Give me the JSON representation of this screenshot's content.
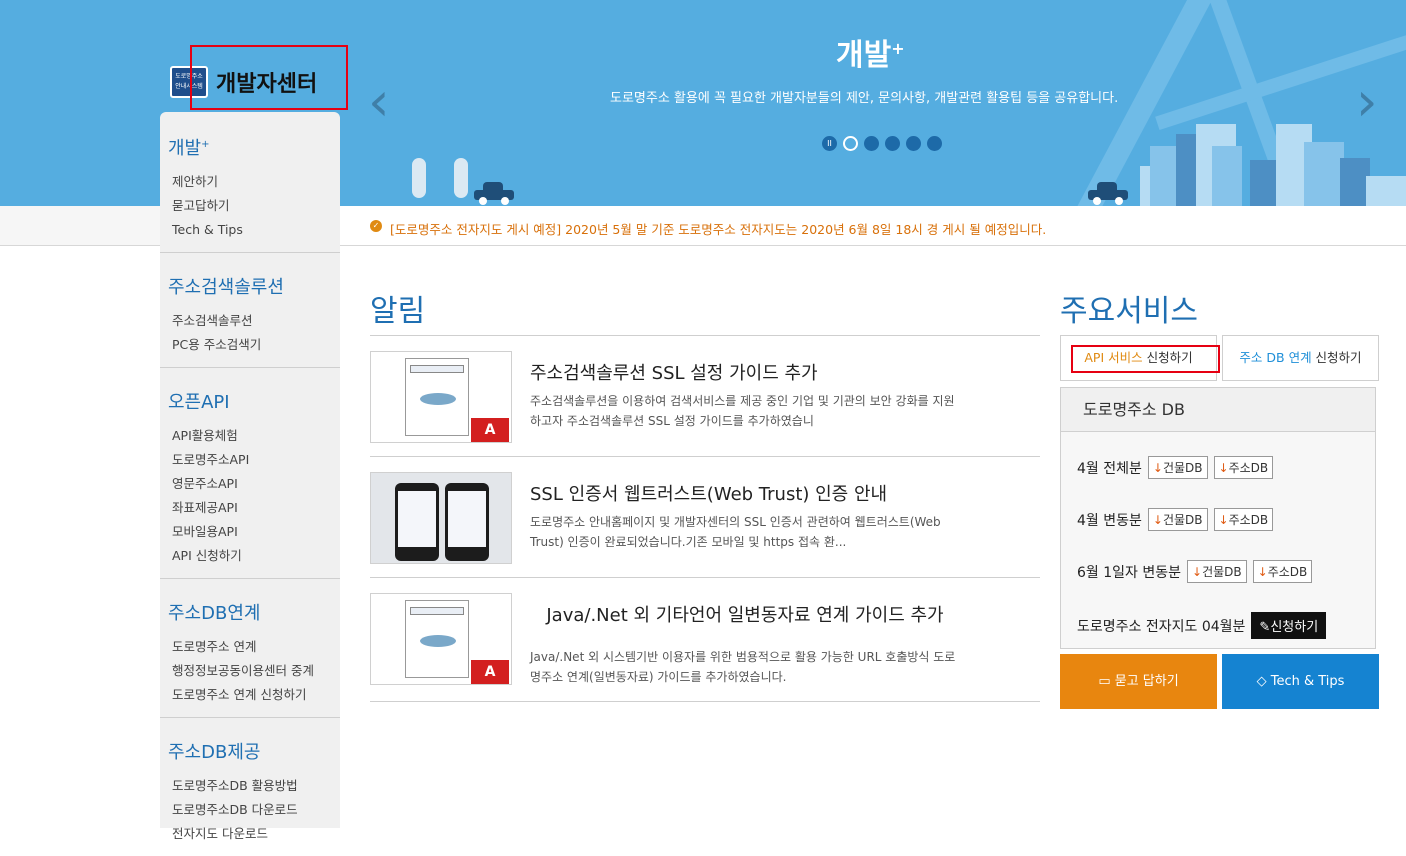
{
  "banner": {
    "title": "개발",
    "title_sup": "+",
    "subtitle": "도로명주소 활용에 꼭 필요한 개발자분들의 제안, 문의사항, 개발관련 활용팁 등을 공유합니다.",
    "prev_arrow": "‹",
    "next_arrow": "›",
    "pause_symbol": "II"
  },
  "logo": {
    "badge_line1": "도로명주소",
    "badge_line2": "안내시스템",
    "text": "개발자센터"
  },
  "sidebar": {
    "sections": [
      {
        "heading": "개발",
        "heading_sup": "+",
        "items": [
          "제안하기",
          "묻고답하기",
          "Tech & Tips"
        ]
      },
      {
        "heading": "주소검색솔루션",
        "items": [
          "주소검색솔루션",
          "PC용 주소검색기"
        ]
      },
      {
        "heading": "오픈API",
        "items": [
          "API활용체험",
          "도로명주소API",
          "영문주소API",
          "좌표제공API",
          "모바일용API",
          "API 신청하기"
        ]
      },
      {
        "heading": "주소DB연계",
        "items": [
          "도로명주소 연계",
          "행정정보공동이용센터 중계",
          "도로명주소 연계 신청하기"
        ]
      },
      {
        "heading": "주소DB제공",
        "items": [
          "도로명주소DB 활용방법",
          "도로명주소DB 다운로드",
          "전자지도 다운로드"
        ]
      }
    ]
  },
  "notice": {
    "icon": "✓",
    "text": "[도로명주소 전자지도 게시 예정] 2020년 5월 말 기준 도로명주소 전자지도는 2020년 6월 8일 18시 경 게시 될 예정입니다."
  },
  "news": {
    "title": "알림",
    "items": [
      {
        "title": "주소검색솔루션 SSL 설정 가이드 추가",
        "desc": "주소검색솔루션을 이용하여 검색서비스를 제공 중인 기업 및 기관의 보안 강화를 지원하고자 주소검색솔루션 SSL 설정 가이드를 추가하였습니",
        "thumb": "pdf-doc"
      },
      {
        "title": "SSL 인증서 웹트러스트(Web Trust) 인증 안내",
        "desc": "도로명주소 안내홈페이지 및 개발자센터의 SSL 인증서 관련하여 웹트러스트(Web Trust) 인증이 완료되었습니다.기존 모바일 및 https 접속 환...",
        "thumb": "phones"
      },
      {
        "title": "Java/.Net 외 기타언어 일변동자료 연계 가이드 추가",
        "desc": "Java/.Net 외 시스템기반 이용자를 위한 범용적으로 활용 가능한 URL 호출방식 도로명주소 연계(일변동자료) 가이드를 추가하였습니다.",
        "thumb": "pdf-doc"
      }
    ],
    "pdf_label": "A"
  },
  "services": {
    "title": "주요서비스",
    "api_apply": {
      "accent": "API 서비스",
      "rest": " 신청하기"
    },
    "db_apply": {
      "accent": "주소 DB 연계",
      "rest": " 신청하기"
    },
    "db": {
      "heading": "도로명주소 DB",
      "rows": [
        {
          "label": "4월 전체분",
          "btn1": "건물DB",
          "btn2": "주소DB"
        },
        {
          "label": "4월 변동분",
          "btn1": "건물DB",
          "btn2": "주소DB"
        },
        {
          "label": "6월 1일자 변동분",
          "btn1": "건물DB",
          "btn2": "주소DB"
        }
      ],
      "map_label": "도로명주소 전자지도 04월분",
      "map_apply": "신청하기",
      "download_arrow": "↓",
      "pen_icon": "✎"
    },
    "qna_button": "묻고 답하기",
    "tips_button": "Tech & Tips",
    "qna_icon": "▭",
    "tips_icon": "◇"
  },
  "colors": {
    "banner": "#55ade0",
    "accent_blue": "#1f6fb2",
    "notice_orange": "#d8700a",
    "qna_orange": "#e8860f",
    "tips_blue": "#1583d1",
    "highlight_red": "#e60012"
  }
}
